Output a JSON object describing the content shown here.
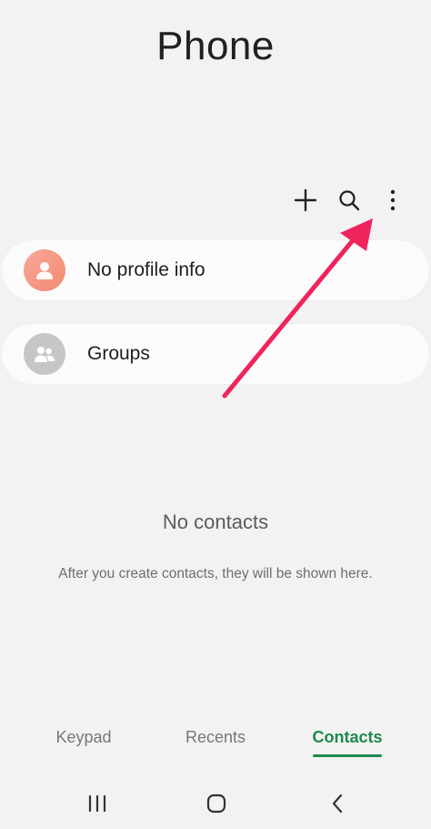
{
  "header": {
    "title": "Phone"
  },
  "toolbar": {
    "icons": [
      "plus-icon",
      "search-icon",
      "more-vertical-icon"
    ]
  },
  "cards": {
    "profile": {
      "label": "No profile info",
      "icon": "person-icon"
    },
    "groups": {
      "label": "Groups",
      "icon": "people-icon"
    }
  },
  "empty_state": {
    "title": "No contacts",
    "subtitle": "After you create contacts, they will be shown here."
  },
  "tabs": {
    "keypad": "Keypad",
    "recents": "Recents",
    "contacts": "Contacts",
    "selected": "Contacts"
  },
  "navbar": {
    "icons": [
      "recent-apps-icon",
      "home-icon",
      "back-icon"
    ]
  },
  "colors": {
    "accent": "#1d8a4f",
    "annotation_arrow": "#f0245c",
    "profile_avatar": "#f48a6f",
    "group_avatar": "#c6c6c6",
    "background": "#f2f2f2"
  }
}
